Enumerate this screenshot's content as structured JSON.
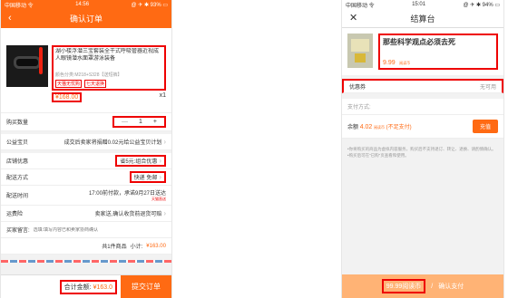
{
  "left": {
    "status": {
      "carrier": "中国移动 令",
      "time": "14:56",
      "right": "@ ✈ ✱ 93% ▭"
    },
    "title": "确认订单",
    "product": {
      "name": "湖小楼浮潜三宝套装全干式呼吸管器近视成人眼镜潜水面罩游泳装备",
      "spec": "颜色分类:M218+S328【送短裤】",
      "tags": [
        "天猫无忧购",
        "七天退换"
      ],
      "price": "¥168.00",
      "qty": "x1"
    },
    "quantity": {
      "label": "购买数量",
      "minus": "—",
      "value": "1",
      "plus": "+"
    },
    "charity": {
      "label": "公益宝贝",
      "text": "成交后卖家将捐赠0.02元给公益宝贝计划"
    },
    "shop_discount": {
      "label": "店铺优惠",
      "value": "省5元:组合优惠"
    },
    "delivery": {
      "label": "配送方式",
      "value": "快递 免邮"
    },
    "delivery_time": {
      "label": "配送时间",
      "value": "17:00前付款，承诺9月27日送达",
      "badge": "天猫直送"
    },
    "insurance": {
      "label": "运费险",
      "value": "卖家送,确认收货前退货可赔"
    },
    "message": {
      "label": "买家留言:",
      "placeholder": "选填:填写内容已和卖家协商确认"
    },
    "subtotal": {
      "text": "共1件商品",
      "label": "小计:",
      "value": "¥163.00"
    },
    "footer": {
      "total_label": "合计金额:",
      "total_value": "¥163.0",
      "submit": "提交订单"
    }
  },
  "right": {
    "status": {
      "carrier": "中国移动 令",
      "time": "15:01",
      "right": "@ ✈ ✱ 94% ▭"
    },
    "title": "结算台",
    "product": {
      "name": "那些科学观点必须去死",
      "price": "9.99",
      "currency": "阅读币"
    },
    "coupon": {
      "label": "优惠券",
      "value": "无可用"
    },
    "pay": {
      "label": "支付方式:",
      "balance_label": "余额",
      "balance_value": "4.02",
      "balance_unit": "阅读币",
      "insufficient": "(不足支付)",
      "recharge": "充值"
    },
    "notes": [
      "•你将购买的商品为虚拟内容服务，购买后不支持退订、转让、退换、请酌情确认。",
      "•购买后可在\"已购\"页查看和使用。"
    ],
    "footer": {
      "amount": "99.99阅读币",
      "confirm": "确认支付"
    }
  }
}
